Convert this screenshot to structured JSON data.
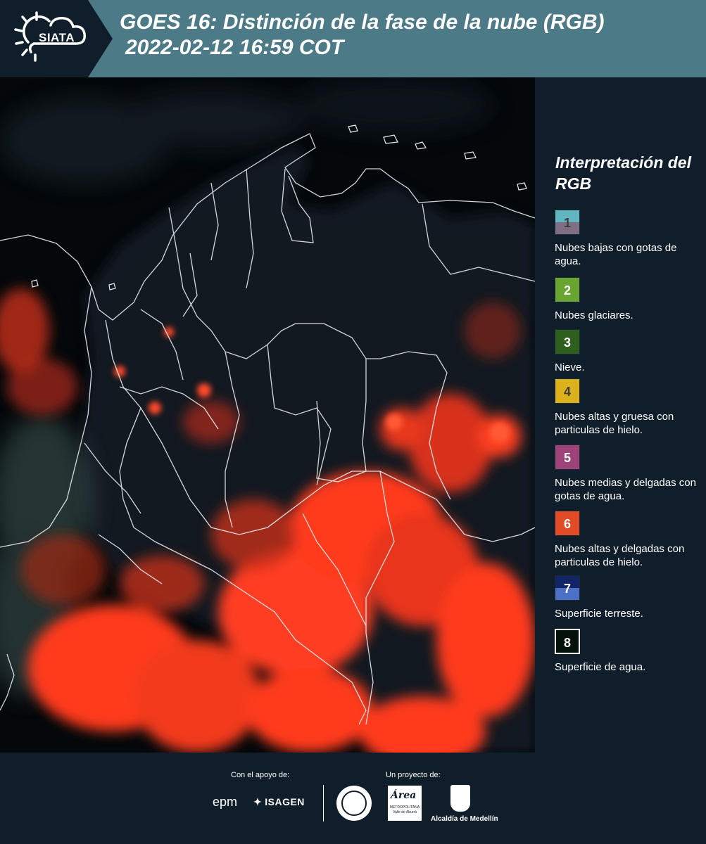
{
  "header": {
    "logo_text": "SIATA",
    "title_line1": "GOES 16: Distinción de la fase de la nube (RGB)",
    "title_line2": "2022-02-12 16:59 COT"
  },
  "map": {
    "icon": "satellite-image"
  },
  "legend": {
    "title": "Interpretación del RGB",
    "items": [
      {
        "number": "1",
        "label": "Nubes bajas con gotas de agua.",
        "colors": [
          "#62b6c2",
          "#7e6f85"
        ]
      },
      {
        "number": "2",
        "label": "Nubes glaciares.",
        "colors": [
          "#6aa430"
        ]
      },
      {
        "number": "3",
        "label": "Nieve.",
        "colors": [
          "#2f5f1d"
        ]
      },
      {
        "number": "4",
        "label": "Nubes altas y gruesa con particulas de hielo.",
        "colors": [
          "#dcb21c"
        ]
      },
      {
        "number": "5",
        "label": "Nubes medias y delgadas con gotas de agua.",
        "colors": [
          "#9d4379"
        ]
      },
      {
        "number": "6",
        "label": "Nubes altas y delgadas con particulas de hielo.",
        "colors": [
          "#e24b27"
        ]
      },
      {
        "number": "7",
        "label": "Superficie terreste.",
        "colors": [
          "#112566",
          "#4b70c6"
        ]
      },
      {
        "number": "8",
        "label": "Superficie de agua.",
        "colors": [
          "#05120a"
        ]
      }
    ]
  },
  "footer": {
    "support_label": "Con el apoyo de:",
    "project_label": "Un proyecto de:",
    "epm": "epm",
    "isagen": "ISAGEN",
    "area_word": "Área",
    "area_sub": "METROPOLITANA Valle de Aburrá",
    "alcaldia": "Alcaldía de Medellín"
  },
  "colors": {
    "header_bg": "#4d7a87",
    "header_dark": "#0f1e2a",
    "legend_bg": "#0f1e2a",
    "cloud_red": "#ff3a1e"
  }
}
